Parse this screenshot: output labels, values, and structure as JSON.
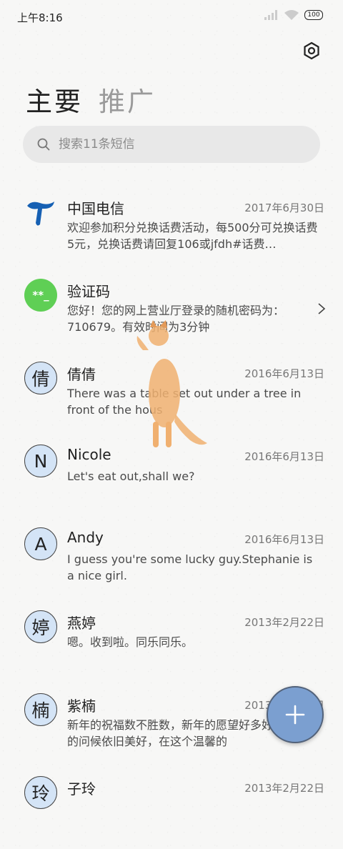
{
  "status_bar": {
    "time": "上午8:16",
    "battery": "100"
  },
  "tabs": [
    {
      "label": "主要"
    },
    {
      "label": "推广"
    }
  ],
  "search": {
    "placeholder": "搜索11条短信"
  },
  "conversations": [
    {
      "name": "中国电信",
      "date": "2017年6月30日",
      "preview": "欢迎参加积分兑换话费活动，每500分可兑换话费5元，兑换话费请回复106或jfdh#话费…",
      "avatar": "telecom-logo-icon"
    },
    {
      "name": "验证码",
      "date": "",
      "preview": "您好！您的网上营业厅登录的随机密码为：710679。有效时间为3分钟",
      "avatar_text": "**_"
    },
    {
      "name": "倩倩",
      "date": "2016年6月13日",
      "preview": "There was a table set out under a tree in front of the hous",
      "avatar_text": "倩"
    },
    {
      "name": "Nicole",
      "date": "2016年6月13日",
      "preview": "Let's eat out,shall we?",
      "avatar_text": "N"
    },
    {
      "name": "Andy",
      "date": "2016年6月13日",
      "preview": "I guess you're some lucky guy.Stephanie is a nice girl.",
      "avatar_text": "A"
    },
    {
      "name": "燕婷",
      "date": "2013年2月22日",
      "preview": "嗯。收到啦。同乐同乐。",
      "avatar_text": "婷"
    },
    {
      "name": "紫楠",
      "date": "2013年2月22日",
      "preview": "新年的祝福数不胜数，新年的愿望好多好多，新年的问候依旧美好，在这个温馨的",
      "avatar_text": "楠"
    },
    {
      "name": "子玲",
      "date": "2013年2月22日",
      "preview": "",
      "avatar_text": "玲"
    }
  ],
  "colors": {
    "accent": "#7b9fd0",
    "avatar_bg": "#d4e4f6",
    "verify_green": "#5fcf55",
    "telecom_blue": "#1660b3"
  }
}
